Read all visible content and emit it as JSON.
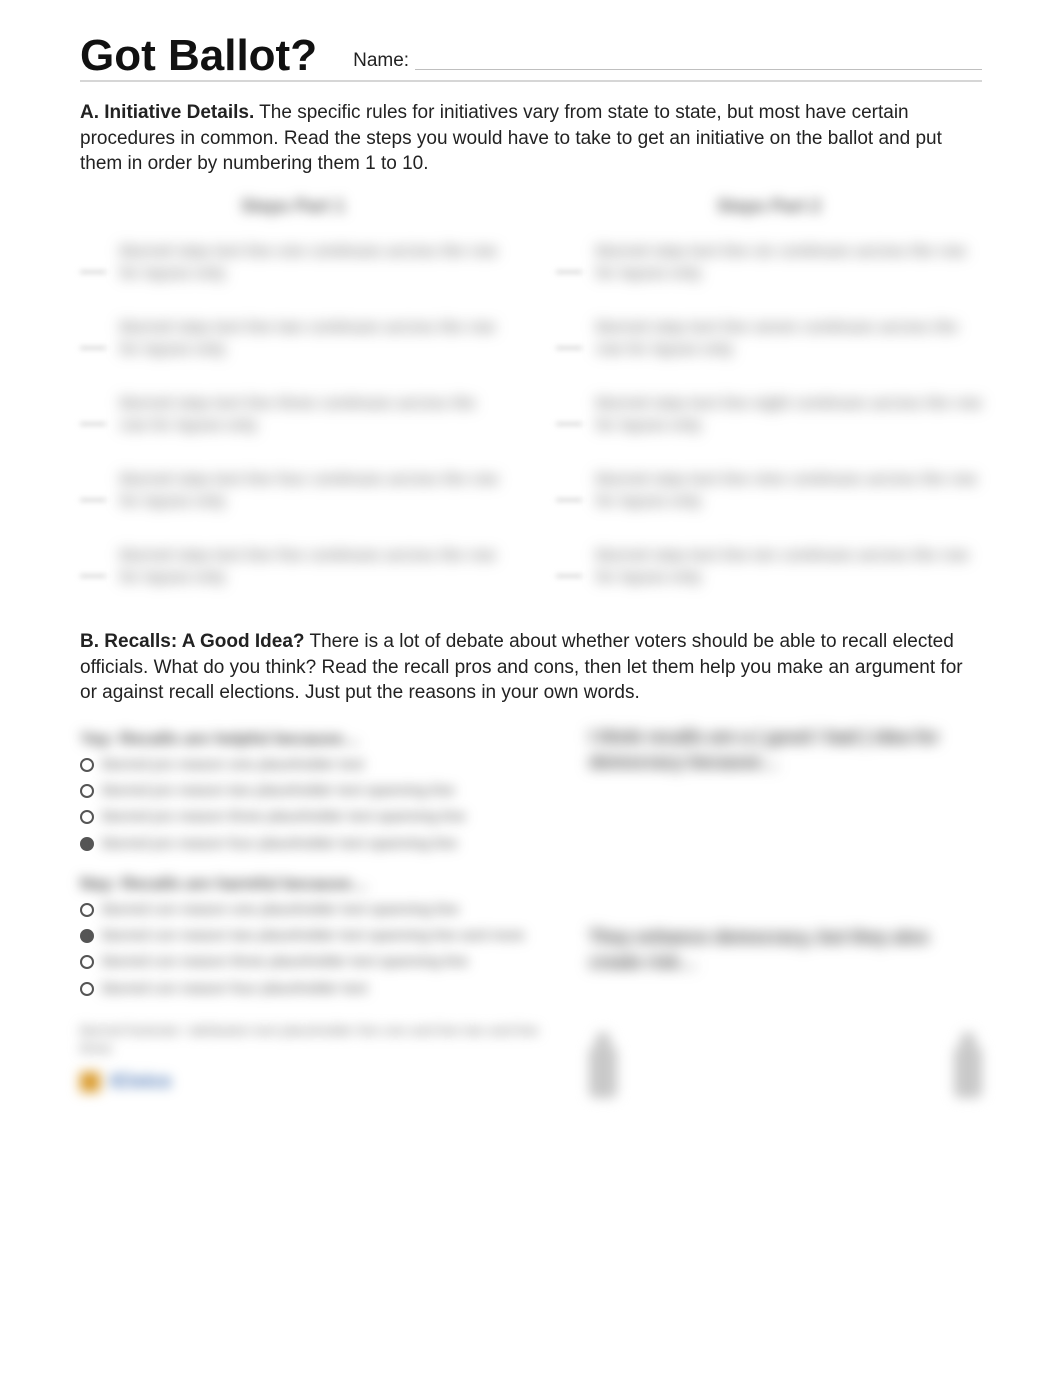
{
  "header": {
    "title": "Got Ballot?",
    "name_label": "Name:"
  },
  "sectionA": {
    "lead_bold": "A. Initiative Details.",
    "lead_rest": " The specific rules for initiatives vary from state to state, but most have certain procedures in common. Read the steps you would have to take to get an initiative on the ballot and put them in order by numbering them 1 to 10.",
    "left_heading": "Steps Part 1",
    "right_heading": "Steps Part 2",
    "left_steps": [
      "blurred step text line one continues across the row for layout only",
      "blurred step text line two continues across the row for layout only",
      "blurred step text line three continues across the row for layout only",
      "blurred step text line four continues across the row for layout only",
      "blurred step text line five continues across the row for layout only"
    ],
    "right_steps": [
      "blurred step text line six continues across the row for layout only",
      "blurred step text line seven continues across the row for layout only",
      "blurred step text line eight continues across the row for layout only",
      "blurred step text line nine continues across the row for layout only",
      "blurred step text line ten continues across the row for layout only"
    ]
  },
  "sectionB": {
    "lead_bold": "B. Recalls: A Good Idea?",
    "lead_rest": " There is a lot of debate about whether voters should be able to recall elected officials. What do you think? Read the recall pros and cons, then let them help you make an argument for or against recall elections. Just put the reasons in your own words.",
    "pros_heading": "Yay: Recalls are helpful because…",
    "pros": [
      "blurred pro reason one placeholder text",
      "blurred pro reason two placeholder text spanning line",
      "blurred pro reason three placeholder text spanning line",
      "blurred pro reason four placeholder text spanning line"
    ],
    "cons_heading": "Nay: Recalls are harmful because…",
    "cons": [
      "blurred con reason one placeholder text spanning line",
      "blurred con reason two placeholder text spanning line and more",
      "blurred con reason three placeholder text spanning line",
      "blurred con reason four placeholder text"
    ],
    "answer1": "I think recalls are a ( good / bad ) idea for democracy because…",
    "answer2": "They enhance democracy, but they also create risk…",
    "footnote": "blurred footnote / attribution text placeholder line one and line two and line three",
    "logo_text": "iCivics"
  }
}
